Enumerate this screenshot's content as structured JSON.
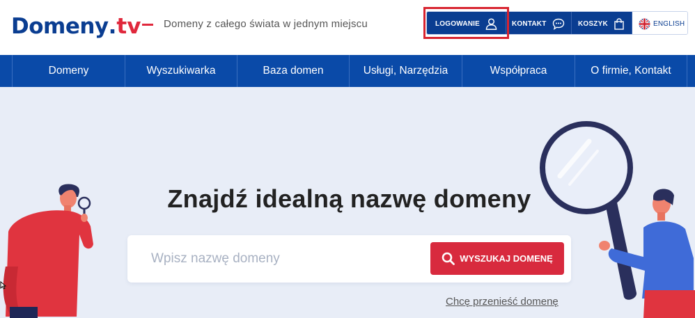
{
  "header": {
    "logo_main": "Domeny",
    "logo_dot": ".",
    "logo_tld": "tv",
    "tagline": "Domeny z całego świata w jednym miejscu",
    "actions": {
      "login_label": "LOGOWANIE",
      "contact_label": "KONTAKT",
      "cart_label": "KOSZYK",
      "language_label": "ENGLISH"
    }
  },
  "nav": {
    "items": [
      {
        "label": "Domeny"
      },
      {
        "label": "Wyszukiwarka"
      },
      {
        "label": "Baza domen"
      },
      {
        "label": "Usługi, Narzędzia"
      },
      {
        "label": "Współpraca"
      },
      {
        "label": "O firmie, Kontakt"
      }
    ]
  },
  "hero": {
    "title": "Znajdź idealną nazwę domeny",
    "search_placeholder": "Wpisz nazwę domeny",
    "search_value": "",
    "search_button": "WYSZUKAJ DOMENĘ",
    "transfer_link": "Chcę przenieść domenę"
  },
  "colors": {
    "brand_blue": "#0a3d91",
    "nav_blue": "#0a4aa8",
    "accent_red": "#d82a3e",
    "hero_background": "#e8edf7"
  },
  "icons": {
    "login": "user-icon",
    "contact": "chat-bubble-icon",
    "cart": "shopping-bag-icon",
    "language": "uk-flag-icon",
    "search": "search-icon"
  }
}
